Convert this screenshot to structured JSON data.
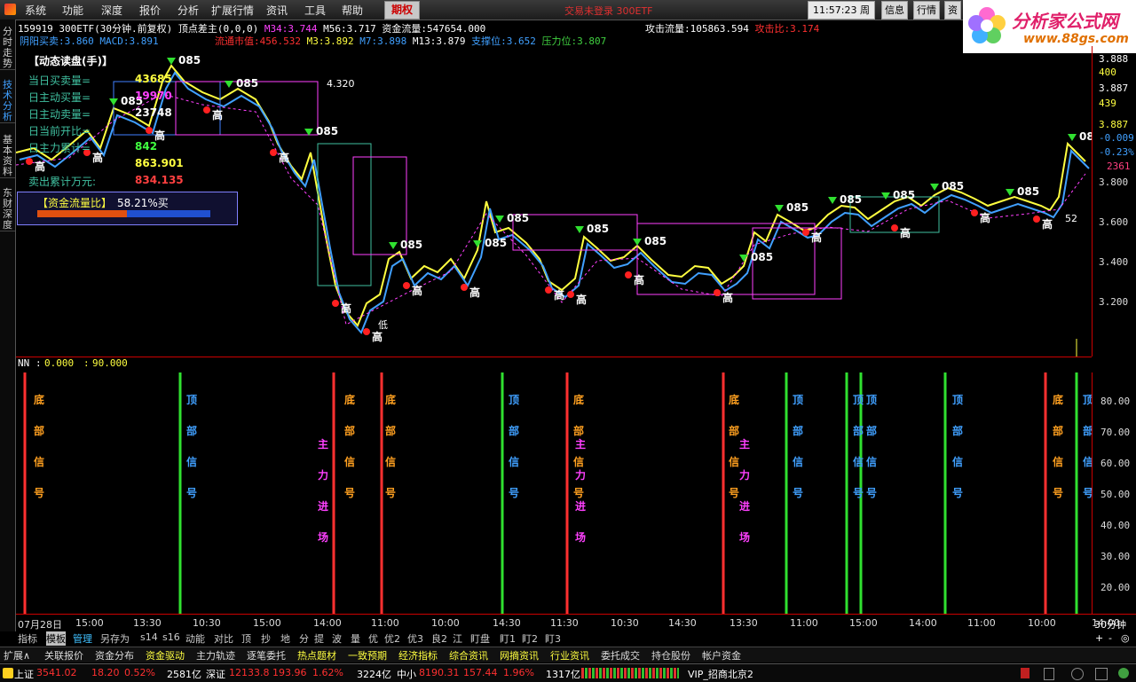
{
  "menu": {
    "items": [
      "系统",
      "功能",
      "深度",
      "报价",
      "分析",
      "扩展行情",
      "资讯",
      "工具",
      "帮助"
    ],
    "options_label": "期权",
    "trade_info": "交易未登录   300ETF",
    "clock": "11:57:23",
    "weekday": "周五",
    "buttons": [
      "信息",
      "行情",
      "资"
    ],
    "logo_title": "分析家公式网",
    "logo_url": "www.88gs.com"
  },
  "side_tabs": [
    "分时走势",
    "技术分析",
    "基本资料",
    "东财深度"
  ],
  "info_row1": {
    "code": "159919",
    "name": "300ETF(30分钟.前复权)",
    "indicator": "顶点差主(0,0,0)",
    "m34_label": "M34:",
    "m34": "3.744",
    "m56_label": "M56:",
    "m56": "3.717",
    "fund_flow_label": "资金流量:",
    "fund_flow": "547654.000",
    "attack_label": "攻击流量:",
    "attack": "105863.594",
    "attack_ratio_label": "攻击比:",
    "attack_ratio": "3.174"
  },
  "info_row2": {
    "yinyang_label": "阴阳买卖:",
    "yinyang": "3.860",
    "macd_label": "MACD:",
    "macd": "3.891",
    "market_value_label": "流通市值:",
    "market_value": "456.532",
    "m3_label": "M3:",
    "m3": "3.892",
    "m7_label": "M7:",
    "m7": "3.898",
    "m13_label": "M13:",
    "m13": "3.879",
    "support_label": "支撑位:",
    "support": "3.652",
    "pressure_label": "压力位:",
    "pressure": "3.807"
  },
  "left_panel": {
    "title": "【动态读盘(手)】",
    "rows": [
      {
        "label": "当日买卖量=",
        "value": "43685",
        "color": "#ffff40"
      },
      {
        "label": "日主动买量=",
        "value": "19970",
        "color": "#ff40ff"
      },
      {
        "label": "日主动卖量=",
        "value": "23748",
        "color": "#ffffff"
      },
      {
        "label": "日当前开比=",
        "value": "",
        "color": "#ffffff"
      },
      {
        "label": "日主力累计=",
        "value": "842",
        "color": "#40ff40"
      },
      {
        "label": "",
        "value": "863.901",
        "color": "#ffff40"
      },
      {
        "label": "卖出累计万元:",
        "value": "834.135",
        "color": "#ff4040"
      }
    ],
    "ratio_label": "【资金流量比】",
    "ratio_value": "58.21%买",
    "ratio_red_frac": 0.52
  },
  "price_axis": [
    "3.888",
    "400",
    "3.887",
    "439",
    "3.887",
    "-0.009",
    "-0.23%",
    "2361",
    "3.800",
    "3.600",
    "3.400",
    "3.200"
  ],
  "price_levels": [
    "3.888",
    "3.887",
    "3.800",
    "3.600",
    "3.400",
    "3.200"
  ],
  "chart_annotations": [
    "4.320",
    "085",
    "高",
    "低",
    "52"
  ],
  "indicator_panel": {
    "header_label": "NN",
    "header_value1": "0.000",
    "header_value2": "90.000",
    "y_ticks": [
      "80.00",
      "70.00",
      "60.00",
      "50.00",
      "40.00",
      "30.00",
      "20.00"
    ],
    "signals": [
      {
        "type": "bottom",
        "text": "底部信号"
      },
      {
        "type": "top",
        "text": "顶部信号"
      },
      {
        "type": "main",
        "text": "主力进场"
      },
      {
        "type": "bottom",
        "text": "底部信号"
      },
      {
        "type": "bottom",
        "text": "底部信号"
      },
      {
        "type": "top",
        "text": "顶部信号"
      },
      {
        "type": "bottom",
        "text": "底部信号"
      },
      {
        "type": "main",
        "text": "主力进场"
      },
      {
        "type": "bottom",
        "text": "底部信号"
      },
      {
        "type": "main",
        "text": "主力进场"
      },
      {
        "type": "top",
        "text": "顶部信号"
      },
      {
        "type": "top",
        "text": "顶部信号"
      },
      {
        "type": "top",
        "text": "顶部信号"
      },
      {
        "type": "top",
        "text": "顶部信号"
      },
      {
        "type": "bottom",
        "text": "底部信号"
      },
      {
        "type": "top",
        "text": "顶部信号"
      }
    ]
  },
  "time_axis": [
    "07月28日",
    "15:00",
    "13:30",
    "10:30",
    "15:00",
    "14:00",
    "11:00",
    "10:00",
    "14:30",
    "11:30",
    "10:30",
    "14:30",
    "13:30",
    "11:00",
    "15:00",
    "14:00",
    "11:00",
    "10:00",
    "14:00"
  ],
  "period_label": "30分钟",
  "bottom_tabs": [
    "指标",
    "模板",
    "管理",
    "另存为",
    "s14",
    "s16",
    "动能",
    "对比",
    "顶",
    "抄",
    "地",
    "分",
    "提",
    "波",
    "量",
    "优",
    "优2",
    "优3",
    "良2",
    "江",
    "盯盘",
    "盯1",
    "盯2",
    "盯3"
  ],
  "zoom_controls": [
    "+",
    "-",
    "◎"
  ],
  "links": [
    {
      "label": "扩展∧",
      "color": "#dddddd"
    },
    {
      "label": "关联报价",
      "color": "#dddddd"
    },
    {
      "label": "资金分布",
      "color": "#dddddd"
    },
    {
      "label": "资金驱动",
      "color": "#ffff40"
    },
    {
      "label": "主力轨迹",
      "color": "#dddddd"
    },
    {
      "label": "逐笔委托",
      "color": "#dddddd"
    },
    {
      "label": "热点题材",
      "color": "#ffff40"
    },
    {
      "label": "一致预期",
      "color": "#ffff40"
    },
    {
      "label": "经济指标",
      "color": "#ffff40"
    },
    {
      "label": "综合资讯",
      "color": "#ffff40"
    },
    {
      "label": "网摘资讯",
      "color": "#ffff40"
    },
    {
      "label": "行业资讯",
      "color": "#ffff40"
    },
    {
      "label": "委托成交",
      "color": "#dddddd"
    },
    {
      "label": "持仓股份",
      "color": "#dddddd"
    },
    {
      "label": "帐户资金",
      "color": "#dddddd"
    }
  ],
  "status": {
    "sh_label": "上证",
    "sh_value": "3541.02",
    "sh_change": "18.20",
    "sh_pct": "0.52%",
    "sh_amount": "2581亿",
    "sz_label": "深证",
    "sz_value": "12133.8",
    "sz_change": "193.96",
    "sz_pct": "1.62%",
    "sz_amount": "3224亿",
    "zx_label": "中小",
    "zx_value": "8190.31",
    "zx_change": "157.44",
    "zx_pct": "1.96%",
    "zx_amount": "1317亿",
    "server": "VIP_招商北京2"
  },
  "colors": {
    "up": "#ff3030",
    "down": "#30ff30",
    "bottom_signal": "#ff3030",
    "top_signal": "#30e030",
    "main_signal": "#ff40ff",
    "axis": "#c00000"
  }
}
